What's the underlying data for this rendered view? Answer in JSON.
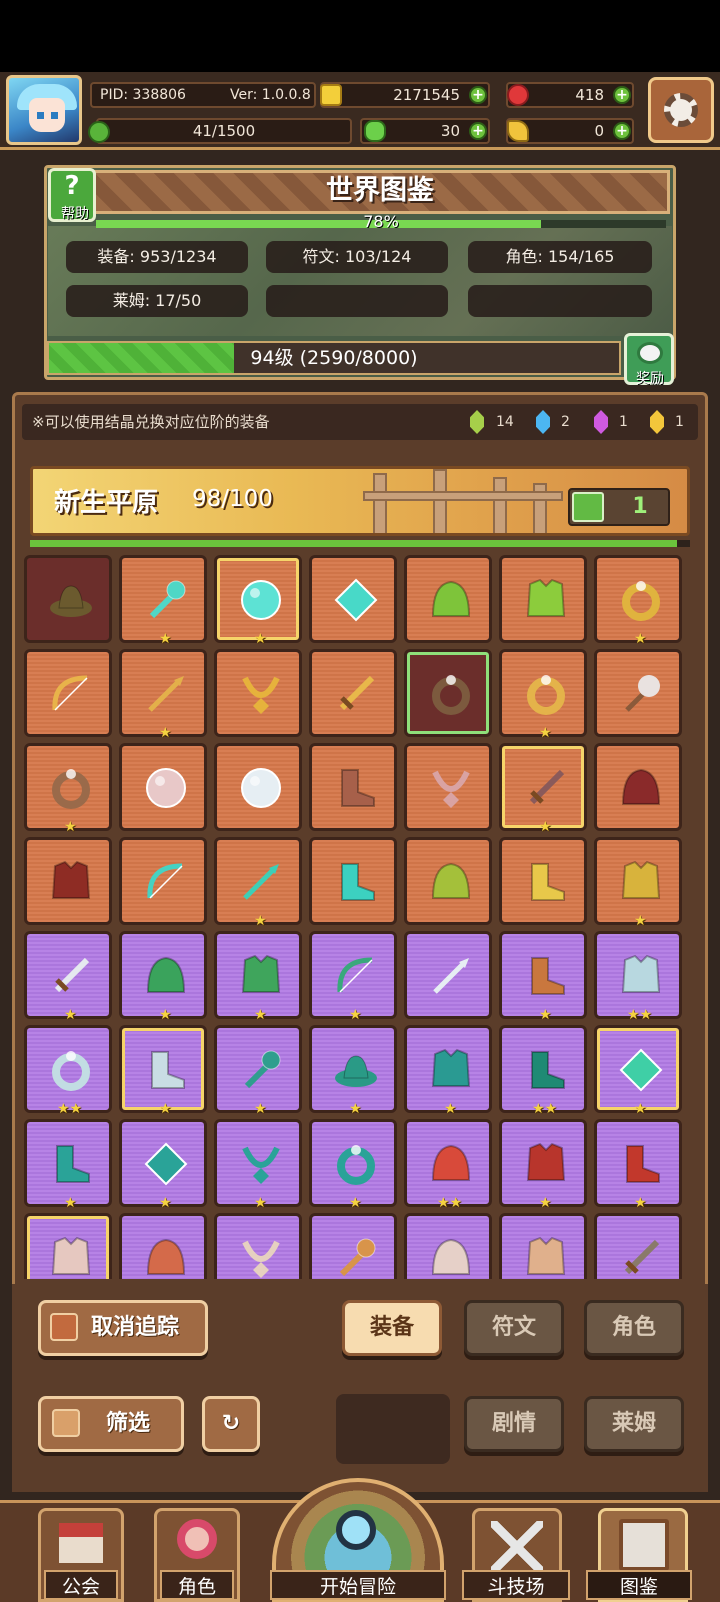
{
  "header": {
    "pid": "PID: 338806",
    "ver": "Ver: 1.0.0.8",
    "gold": "2171545",
    "gems": "418",
    "energy": "41/1500",
    "clover": "30",
    "keys": "0"
  },
  "codex": {
    "title": "世界图鉴",
    "help": "帮助",
    "percent": "78%",
    "percent_value": 0.78,
    "stats": [
      {
        "label": "装备: 953/1234"
      },
      {
        "label": "符文: 103/124"
      },
      {
        "label": "角色: 154/165"
      },
      {
        "label": "莱姆: 17/50"
      }
    ],
    "level": "94级 (2590/8000)",
    "level_fraction": 0.324,
    "reward": "奖励"
  },
  "notice": "※可以使用结晶兑换对应位阶的装备",
  "crystals": [
    {
      "count": "14",
      "color": "#a6cf4a"
    },
    {
      "count": "2",
      "color": "#4cb6f2"
    },
    {
      "count": "1",
      "color": "#cf5ae0"
    },
    {
      "count": "1",
      "color": "#f3c63b"
    }
  ],
  "zone": {
    "name": "新生平原",
    "count": "98/100",
    "likes": "1",
    "progress": 0.98
  },
  "items": [
    {
      "bg": "d",
      "shape": "hat",
      "color": "#6b5a2e",
      "stars": 0
    },
    {
      "bg": "o",
      "shape": "wand",
      "color": "#4fd7c6",
      "stars": 1
    },
    {
      "bg": "o",
      "shape": "orb",
      "color": "#5de2d4",
      "stars": 1,
      "hl": true
    },
    {
      "bg": "o",
      "shape": "gem",
      "color": "#48d9c8",
      "stars": 0
    },
    {
      "bg": "o",
      "shape": "helm",
      "color": "#7ec43a",
      "stars": 0
    },
    {
      "bg": "o",
      "shape": "armor",
      "color": "#8ccc3c",
      "stars": 0
    },
    {
      "bg": "o",
      "shape": "ring",
      "color": "#e0b33e",
      "stars": 1
    },
    {
      "bg": "o",
      "shape": "bow",
      "color": "#e8b34a",
      "stars": 0
    },
    {
      "bg": "o",
      "shape": "spear",
      "color": "#e3b04a",
      "stars": 1
    },
    {
      "bg": "o",
      "shape": "neck",
      "color": "#e6b23c",
      "stars": 0
    },
    {
      "bg": "o",
      "shape": "sword",
      "color": "#e8b84a",
      "stars": 0
    },
    {
      "bg": "d",
      "shape": "ring",
      "color": "#7c5a3e",
      "stars": 0,
      "gl": true
    },
    {
      "bg": "o",
      "shape": "ring",
      "color": "#e4b34a",
      "stars": 1
    },
    {
      "bg": "o",
      "shape": "axe",
      "color": "#e9e2e0",
      "stars": 0
    },
    {
      "bg": "o",
      "shape": "ring",
      "color": "#9a6a4a",
      "stars": 1
    },
    {
      "bg": "o",
      "shape": "orb",
      "color": "#e8c8c8",
      "stars": 0
    },
    {
      "bg": "o",
      "shape": "orb",
      "color": "#e6eef3",
      "stars": 0
    },
    {
      "bg": "o",
      "shape": "boot",
      "color": "#a7604a",
      "stars": 0
    },
    {
      "bg": "o",
      "shape": "neck",
      "color": "#d9a3a3",
      "stars": 0
    },
    {
      "bg": "o",
      "shape": "sword",
      "color": "#8a5a5a",
      "stars": 1,
      "hl": true
    },
    {
      "bg": "o",
      "shape": "helm",
      "color": "#8a2a2a",
      "stars": 0
    },
    {
      "bg": "o",
      "shape": "armor",
      "color": "#8e2c24",
      "stars": 0
    },
    {
      "bg": "o",
      "shape": "bow",
      "color": "#46d2c2",
      "stars": 0
    },
    {
      "bg": "o",
      "shape": "spear",
      "color": "#3dcfb6",
      "stars": 1
    },
    {
      "bg": "o",
      "shape": "boot",
      "color": "#3cd1c0",
      "stars": 0
    },
    {
      "bg": "o",
      "shape": "helm",
      "color": "#a4c03a",
      "stars": 0
    },
    {
      "bg": "o",
      "shape": "boot",
      "color": "#e8c84a",
      "stars": 0
    },
    {
      "bg": "o",
      "shape": "armor",
      "color": "#d8b33c",
      "stars": 1
    },
    {
      "bg": "p",
      "shape": "sword",
      "color": "#e5e9ef",
      "stars": 1
    },
    {
      "bg": "p",
      "shape": "helm",
      "color": "#3aa35c",
      "stars": 1
    },
    {
      "bg": "p",
      "shape": "armor",
      "color": "#3fa55c",
      "stars": 1
    },
    {
      "bg": "p",
      "shape": "bow",
      "color": "#3aa87c",
      "stars": 1
    },
    {
      "bg": "p",
      "shape": "spear",
      "color": "#e6eef3",
      "stars": 0
    },
    {
      "bg": "p",
      "shape": "boot",
      "color": "#c9773e",
      "stars": 1
    },
    {
      "bg": "p",
      "shape": "armor",
      "color": "#b8d8e0",
      "stars": 2
    },
    {
      "bg": "p",
      "shape": "ring",
      "color": "#c2dde3",
      "stars": 2
    },
    {
      "bg": "p",
      "shape": "boot",
      "color": "#c9dde4",
      "stars": 1,
      "hl": true
    },
    {
      "bg": "p",
      "shape": "wand",
      "color": "#2f9e8e",
      "stars": 1
    },
    {
      "bg": "p",
      "shape": "hat",
      "color": "#2a9a86",
      "stars": 1
    },
    {
      "bg": "p",
      "shape": "armor",
      "color": "#2a9a92",
      "stars": 1
    },
    {
      "bg": "p",
      "shape": "boot",
      "color": "#1f8a74",
      "stars": 2
    },
    {
      "bg": "p",
      "shape": "gem",
      "color": "#3fcfa6",
      "stars": 1,
      "hl": true
    },
    {
      "bg": "p",
      "shape": "boot",
      "color": "#2aa398",
      "stars": 1
    },
    {
      "bg": "p",
      "shape": "gem",
      "color": "#2aa398",
      "stars": 1
    },
    {
      "bg": "p",
      "shape": "neck",
      "color": "#2aa398",
      "stars": 1
    },
    {
      "bg": "p",
      "shape": "ring",
      "color": "#2aa398",
      "stars": 1
    },
    {
      "bg": "p",
      "shape": "helm",
      "color": "#d84a3a",
      "stars": 2
    },
    {
      "bg": "p",
      "shape": "armor",
      "color": "#b8352c",
      "stars": 1
    },
    {
      "bg": "p",
      "shape": "boot",
      "color": "#c2382c",
      "stars": 1
    },
    {
      "bg": "p",
      "shape": "armor",
      "color": "#e6c8c0",
      "stars": 0,
      "hl": true
    },
    {
      "bg": "p",
      "shape": "helm",
      "color": "#d46a4a",
      "stars": 0
    },
    {
      "bg": "p",
      "shape": "neck",
      "color": "#e6d0c0",
      "stars": 0
    },
    {
      "bg": "p",
      "shape": "wand",
      "color": "#d8944a",
      "stars": 0
    },
    {
      "bg": "p",
      "shape": "helm",
      "color": "#e6d0c8",
      "stars": 0
    },
    {
      "bg": "p",
      "shape": "armor",
      "color": "#e0b08c",
      "stars": 0
    },
    {
      "bg": "p",
      "shape": "sword",
      "color": "#8a7a6a",
      "stars": 0
    }
  ],
  "controls": {
    "untrack": "取消追踪",
    "filter": "筛选",
    "tabs": [
      "装备",
      "符文",
      "角色",
      "剧情",
      "莱姆"
    ]
  },
  "nav": {
    "guild": "公会",
    "role": "角色",
    "start": "开始冒险",
    "arena": "斗技场",
    "codex": "图鉴"
  }
}
